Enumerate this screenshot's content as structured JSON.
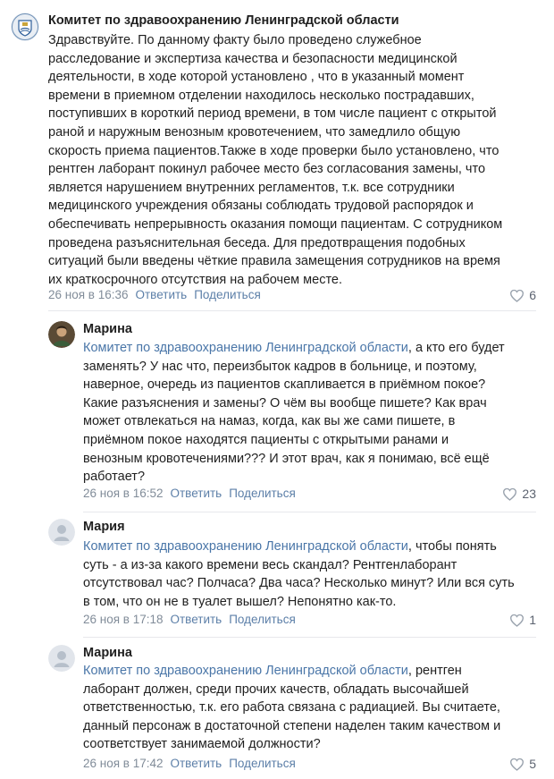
{
  "comments": [
    {
      "author": "Комитет по здравоохранению Ленинградской области",
      "lines": [
        "Здравствуйте. По данному факту было проведено служебное",
        "расследование и экспертиза качества и безопасности медицинской",
        "деятельности, в ходе которой установлено , что в указанный момент",
        "времени в приемном отделении находилось несколько пострадавших,",
        "поступивших в короткий период времени, в том числе пациент с открытой",
        "раной и наружным венозным кровотечением, что замедлило общую",
        "скорость приема пациентов.Также в ходе проверки было установлено, что",
        "рентген лаборант покинул рабочее место без согласования замены, что",
        "является нарушением внутренних регламентов, т.к. все сотрудники",
        "медицинского учреждения обязаны соблюдать трудовой распорядок и",
        "обеспечивать непрерывность оказания помощи пациентам. С сотрудником",
        "проведена разъяснительная беседа. Для предотвращения подобных",
        "ситуаций были введены чёткие правила замещения сотрудников на время",
        "их краткосрочного отсутствия на рабочем месте."
      ],
      "date": "26 ноя в 16:36",
      "reply": "Ответить",
      "share": "Поделиться",
      "likes": "6"
    },
    {
      "author": "Марина",
      "mention": "Комитет по здравоохранению Ленинградской области",
      "first_rest": ", а кто его будет",
      "lines": [
        "заменять? У нас что, переизбыток кадров в больнице, и поэтому,",
        "наверное, очередь из пациентов скапливается в приёмном покое?",
        "Какие разъяснения и замены? О чём вы вообще пишете? Как врач",
        "может отвлекаться на намаз, когда, как вы же сами пишете, в",
        "приёмном покое находятся пациенты с открытыми ранами и",
        "венозным кровотечениями??? И этот врач, как я понимаю, всё ещё",
        "работает?"
      ],
      "date": "26 ноя в 16:52",
      "reply": "Ответить",
      "share": "Поделиться",
      "likes": "23"
    },
    {
      "author": "Мария",
      "mention": "Комитет по здравоохранению Ленинградской области",
      "first_rest": ", чтобы понять",
      "lines": [
        "суть - а из-за какого времени весь скандал? Рентгенлаборант",
        "отсутствовал час? Полчаса? Два часа? Несколько минут? Или вся суть",
        "в том, что он не в туалет вышел? Непонятно как-то."
      ],
      "date": "26 ноя в 17:18",
      "reply": "Ответить",
      "share": "Поделиться",
      "likes": "1"
    },
    {
      "author": "Марина",
      "mention": "Комитет по здравоохранению Ленинградской области",
      "first_rest": ", рентген",
      "lines": [
        "лаборант должен, среди прочих качеств, обладать высочайшей",
        "ответственностью, т.к. его работа связана с радиацией. Вы считаете,",
        "данный персонаж в достаточной степени наделен таким качеством и",
        "соответствует занимаемой должности?"
      ],
      "date": "26 ноя в 17:42",
      "reply": "Ответить",
      "share": "Поделиться",
      "likes": "5"
    }
  ],
  "colors": {
    "link": "#4a76a8",
    "meta": "#818c99",
    "separator": "#e7e8ec"
  }
}
